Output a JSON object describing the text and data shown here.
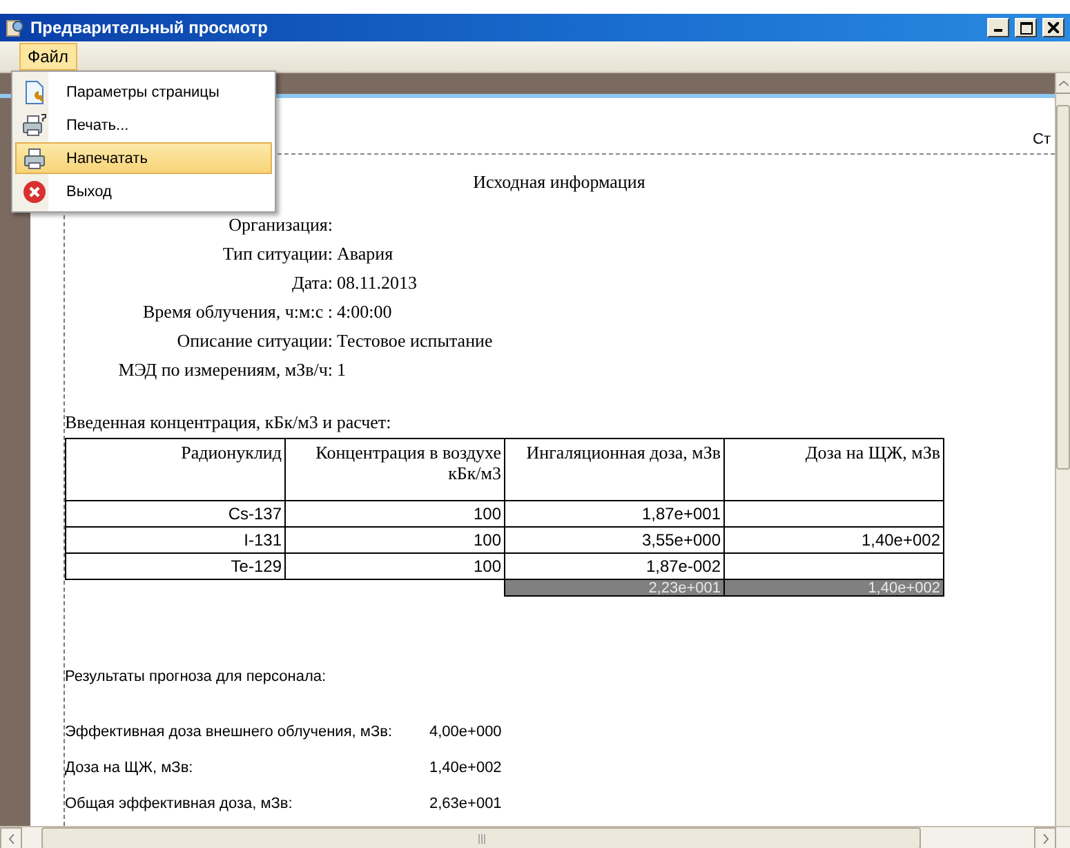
{
  "window": {
    "title": "Предварительный просмотр"
  },
  "menu_bar": [
    {
      "label": "Файл",
      "selected": true
    }
  ],
  "file_menu": [
    {
      "label": "Параметры страницы",
      "selected": false
    },
    {
      "label": "Печать...",
      "selected": false
    },
    {
      "label": "Напечатать",
      "selected": true
    },
    {
      "label": "Выход",
      "selected": false
    }
  ],
  "page_header": "Ст",
  "document": {
    "title": "Исходная информация",
    "fields": [
      {
        "label": "Организация:"
      },
      {
        "label": "Тип ситуации:",
        "value": "Авария"
      },
      {
        "label": "Дата:",
        "value": "08.11.2013"
      },
      {
        "label": "Время облучения, ч:м:с :",
        "value": "4:00:00"
      },
      {
        "label": "Описание ситуации:",
        "value": "Тестовое испытание"
      },
      {
        "label": "МЭД по измерениям, мЗв/ч:",
        "value": "1"
      }
    ],
    "table_caption": "Введенная концентрация, кБк/м3 и расчет:",
    "table": {
      "columns": [
        "Радионуклид",
        "Концентрация в воздухе кБк/м3",
        "Ингаляционная доза, мЗв",
        "Доза на ЩЖ, мЗв"
      ],
      "rows": [
        [
          "Cs-137",
          "100",
          "1,87e+001",
          ""
        ],
        [
          "I-131",
          "100",
          "3,55e+000",
          "1,40e+002"
        ],
        [
          "Te-129",
          "100",
          "1,87e-002",
          ""
        ]
      ],
      "totals": [
        "2,23e+001",
        "1,40e+002"
      ]
    },
    "results_title": "Результаты прогноза для персонала:",
    "results": [
      {
        "label": "Эффективная доза внешнего облучения, мЗв:",
        "value": "4,00e+000"
      },
      {
        "label": "Доза на ЩЖ, мЗв:",
        "value": "1,40e+002"
      },
      {
        "label": "Общая эффективная доза, мЗв:",
        "value": "2,63e+001"
      }
    ]
  }
}
